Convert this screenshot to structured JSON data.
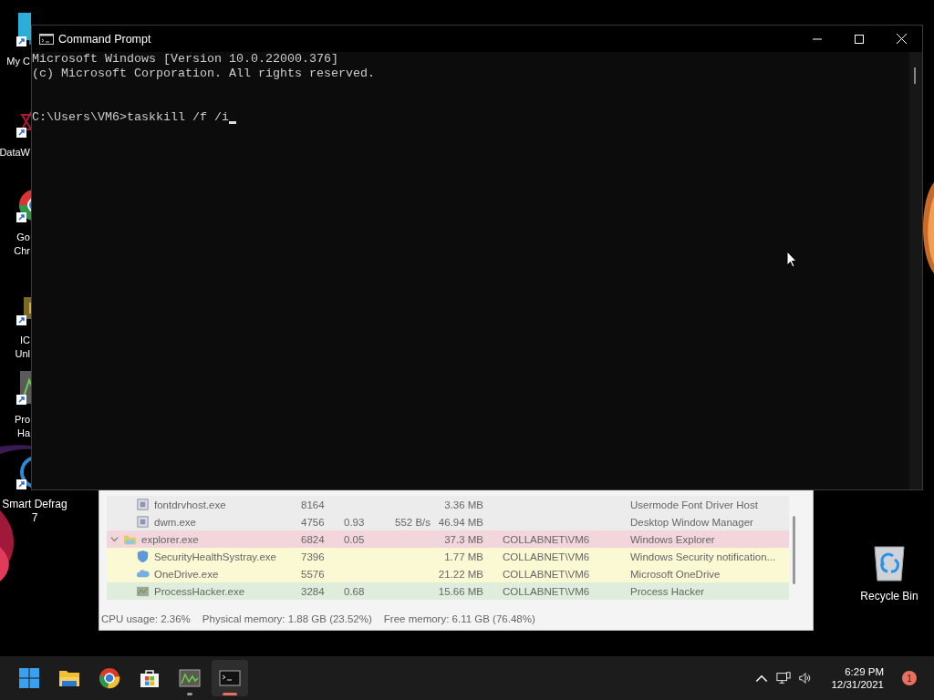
{
  "desktop_icons": [
    {
      "kind": "monitor",
      "lines": [
        "My C"
      ]
    },
    {
      "kind": "web",
      "lines": [
        "DataW"
      ]
    },
    {
      "kind": "browser",
      "lines": [
        "Go",
        "Chr"
      ]
    },
    {
      "kind": "chip",
      "lines": [
        "IC",
        "Unl"
      ]
    },
    {
      "kind": "chart",
      "lines": [
        "Pro",
        "Ha"
      ]
    },
    {
      "kind": "disc",
      "lines": [
        "Smart Defrag",
        "7"
      ]
    }
  ],
  "recycle_bin": {
    "label": "Recycle Bin"
  },
  "process_window": {
    "rows": [
      {
        "kind": "app",
        "color": "#ececec",
        "name": "fontdrvhost.exe",
        "column_2": "8164",
        "column_5": "3.36 MB",
        "column_7": "Usermode Font Driver Host"
      },
      {
        "kind": "app",
        "color": "#ececec",
        "name": "dwm.exe",
        "column_2": "4756",
        "column_3": "0.93",
        "column_4": "552 B/s",
        "column_5": "46.94 MB",
        "column_7": "Desktop Window Manager"
      },
      {
        "kind": "folder",
        "color": "#f2d6db",
        "name": "explorer.exe",
        "column_2": "6824",
        "column_3": "0.05",
        "column_5": "37.3 MB",
        "column_6": "COLLABNET\\VM6",
        "column_7": "Windows Explorer",
        "expanded": true,
        "children": [
          {
            "kind": "shield",
            "color": "#fbf8d4",
            "name": "SecurityHealthSystray.exe",
            "column_2": "7396",
            "column_5": "1.77 MB",
            "column_6": "COLLABNET\\VM6",
            "column_7": "Windows Security notification..."
          },
          {
            "kind": "cloud",
            "color": "#fbf8d4",
            "name": "OneDrive.exe",
            "column_2": "5576",
            "column_5": "21.22 MB",
            "column_6": "COLLABNET\\VM6",
            "column_7": "Microsoft OneDrive"
          },
          {
            "kind": "chart",
            "color": "#dfeedc",
            "name": "ProcessHacker.exe",
            "column_2": "3284",
            "column_3": "0.68",
            "column_5": "15.66 MB",
            "column_6": "COLLABNET\\VM6",
            "column_7": "Process Hacker"
          }
        ]
      }
    ],
    "status_bar": [
      "CPU usage: 2.36%",
      "Physical memory: 1.88 GB (23.52%)",
      "Free memory: 6.11 GB (76.48%)"
    ]
  },
  "console_window": {
    "title": "Command Prompt",
    "output": [
      "Microsoft Windows [Version 10.0.22000.376]",
      "(c) Microsoft Corporation. All rights reserved."
    ],
    "prompt": "C:\\Users\\VM6>",
    "input": "taskkill /f /i"
  },
  "taskbar": {
    "items": [
      {
        "kind": "start",
        "open": false,
        "selected": false
      },
      {
        "kind": "folder",
        "open": false,
        "selected": false
      },
      {
        "kind": "browser",
        "open": false,
        "selected": false
      },
      {
        "kind": "store",
        "open": false,
        "selected": false
      },
      {
        "kind": "chart",
        "open": true,
        "selected": false
      },
      {
        "kind": "terminal",
        "open": true,
        "selected": true
      }
    ],
    "time": "6:29 PM",
    "date": "12/31/2021",
    "notifications": "1"
  }
}
